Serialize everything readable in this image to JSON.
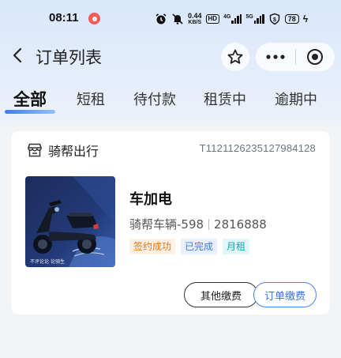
{
  "status_bar": {
    "time": "08:11",
    "net_speed_top": "0.44",
    "net_speed_bottom": "KB/S",
    "hd_label": "HD",
    "sim1_label": "4G",
    "sim2_label": "5G",
    "battery": "78"
  },
  "nav": {
    "title": "订单列表"
  },
  "tabs": [
    {
      "label": "全部",
      "active": true
    },
    {
      "label": "短租",
      "active": false
    },
    {
      "label": "待付款",
      "active": false
    },
    {
      "label": "租赁中",
      "active": false
    },
    {
      "label": "逾期中",
      "active": false
    }
  ],
  "order": {
    "shop_name": "骑帮出行",
    "order_no": "T1121126235127984128",
    "product_name": "车加电",
    "vehicle_name": "骑帮车辆-598",
    "vehicle_id": "2816888",
    "badges": {
      "signed": "签约成功",
      "done": "已完成",
      "monthly": "月租"
    },
    "thumb_caption": "不评论论·论骑生",
    "buttons": {
      "other_fee": "其他缴费",
      "order_fee": "订单缴费"
    }
  },
  "colors": {
    "accent": "#3b7cf4",
    "signed": "#e0781c",
    "done": "#3f7ae0",
    "monthly": "#1aa3b8"
  },
  "icons": [
    "back-icon",
    "star-icon",
    "more-icon",
    "target-icon",
    "shop-icon",
    "alarm-icon",
    "mute-icon",
    "wifi-icon",
    "battery-icon",
    "record-icon"
  ]
}
